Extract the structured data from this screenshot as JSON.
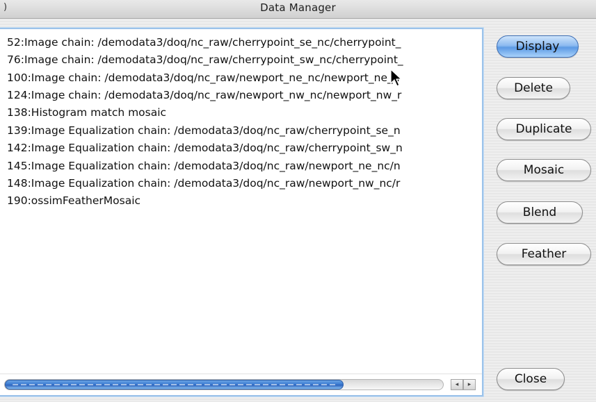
{
  "window": {
    "title": "Data Manager",
    "title_left_glyph": ")"
  },
  "list": {
    "items": [
      "52:Image chain: /demodata3/doq/nc_raw/cherrypoint_se_nc/cherrypoint_",
      "76:Image chain: /demodata3/doq/nc_raw/cherrypoint_sw_nc/cherrypoint_",
      "100:Image chain: /demodata3/doq/nc_raw/newport_ne_nc/newport_ne_n",
      "124:Image chain: /demodata3/doq/nc_raw/newport_nw_nc/newport_nw_r",
      "138:Histogram match mosaic",
      "139:Image Equalization chain: /demodata3/doq/nc_raw/cherrypoint_se_n",
      "142:Image Equalization chain: /demodata3/doq/nc_raw/cherrypoint_sw_n",
      "145:Image Equalization chain: /demodata3/doq/nc_raw/newport_ne_nc/n",
      "148:Image Equalization chain: /demodata3/doq/nc_raw/newport_nw_nc/r",
      "190:ossimFeatherMosaic"
    ],
    "scroll_left_arrow": "◂",
    "scroll_right_arrow": "▸",
    "scroll_thumb_fraction": 0.77
  },
  "buttons": {
    "display": "Display",
    "delete": "Delete",
    "duplicate": "Duplicate",
    "mosaic": "Mosaic",
    "blend": "Blend",
    "feather": "Feather",
    "close": "Close"
  },
  "colors": {
    "selection_border": "#9cc3ea",
    "default_button": "#5c9ae4",
    "scroll_thumb": "#3b7bd1"
  }
}
